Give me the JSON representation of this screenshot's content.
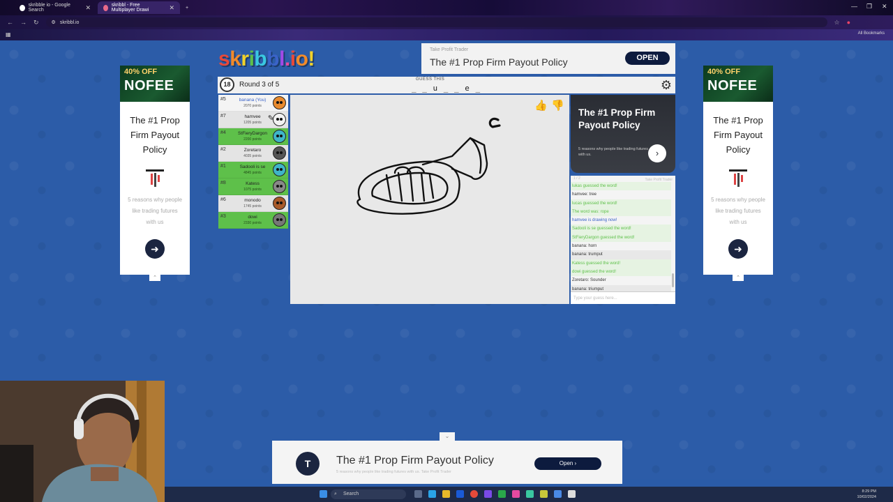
{
  "browser": {
    "tabs": [
      {
        "label": "skribble io - Google Search",
        "active": false
      },
      {
        "label": "skribbl - Free Multiplayer Drawi",
        "active": true
      }
    ],
    "new_tab": "+",
    "address": "skribbl.io",
    "bookmarks_label": "All Bookmarks"
  },
  "logo": {
    "text": "skribbl.io!"
  },
  "top_ad": {
    "brand": "Take Profit Trader",
    "title": "The #1 Prop Firm Payout Policy",
    "button": "OPEN"
  },
  "side_ad": {
    "banner_pct": "40% OFF",
    "banner_main": "NOFEE",
    "headline": "The #1 Prop Firm Payout Policy",
    "sub": "5 reasons why people like trading futures with us"
  },
  "header": {
    "timer": "18",
    "round": "Round 3 of 5",
    "guess_label": "GUESS THIS",
    "guess_word": "_ _ u _ _ e _"
  },
  "players": [
    {
      "rank": "#5",
      "name": "banana (You)",
      "points": "2070 points",
      "style": "white",
      "me": true,
      "avatar_color": "#e88a2e"
    },
    {
      "rank": "#7",
      "name": "hamvee",
      "points": "1205 points",
      "style": "gray",
      "me": false,
      "avatar_color": "#f2f2f2",
      "drawing": true
    },
    {
      "rank": "#4",
      "name": "StFieryDargon",
      "points": "2200 points",
      "style": "green",
      "me": false,
      "avatar_color": "#3fb5c8"
    },
    {
      "rank": "#2",
      "name": "Zoretaro",
      "points": "4035 points",
      "style": "gray",
      "me": false,
      "avatar_color": "#555555"
    },
    {
      "rank": "#1",
      "name": "Sadooli is se",
      "points": "4845 points",
      "style": "green",
      "me": false,
      "avatar_color": "#3fb5c8"
    },
    {
      "rank": "#8",
      "name": "Katess",
      "points": "1075 points",
      "style": "green",
      "me": false,
      "avatar_color": "#888888"
    },
    {
      "rank": "#6",
      "name": "monodo",
      "points": "1745 points",
      "style": "gray",
      "me": false,
      "avatar_color": "#a85a2a"
    },
    {
      "rank": "#3",
      "name": "dowi",
      "points": "2330 points",
      "style": "green",
      "me": false,
      "avatar_color": "#777777"
    }
  ],
  "speech_bubble": "triumput",
  "canvas": {
    "scribble": "c"
  },
  "right_ad": {
    "title": "The #1 Prop Firm Payout Policy",
    "sub": "5 reasons why people like trading futures with us.",
    "tag_left": "1 / 2",
    "tag_right": "Take Profit Trader"
  },
  "chat": [
    {
      "text": "lukas guessed the word!",
      "kind": "g"
    },
    {
      "text": "hamvee: tree",
      "kind": "n"
    },
    {
      "text": "lucas guessed the word!",
      "kind": "g"
    },
    {
      "text": "The word was: rope",
      "kind": "g"
    },
    {
      "text": "hamvee is drawing now!",
      "kind": "b"
    },
    {
      "text": "Sadooli is se guessed the word!",
      "kind": "g"
    },
    {
      "text": "StFieryDargon guessed the word!",
      "kind": "g"
    },
    {
      "text": "banana: horn",
      "kind": "n"
    },
    {
      "text": "banana: trumput",
      "kind": "n alt"
    },
    {
      "text": "Katess guessed the word!",
      "kind": "g"
    },
    {
      "text": "dowi guessed the word!",
      "kind": "g"
    },
    {
      "text": "Zoretaro: Sounder",
      "kind": "n"
    },
    {
      "text": "banana: triumput",
      "kind": "n alt"
    }
  ],
  "chat_input_placeholder": "Type your guess here...",
  "bottom_ad": {
    "logo": "T",
    "title": "The #1 Prop Firm Payout Policy",
    "sub": "5 reasons why people like trading futures with us. Take Profit Trader",
    "button": "Open ›"
  },
  "taskbar": {
    "search": "Search",
    "time": "8:29 PM",
    "date": "10/02/2024"
  }
}
